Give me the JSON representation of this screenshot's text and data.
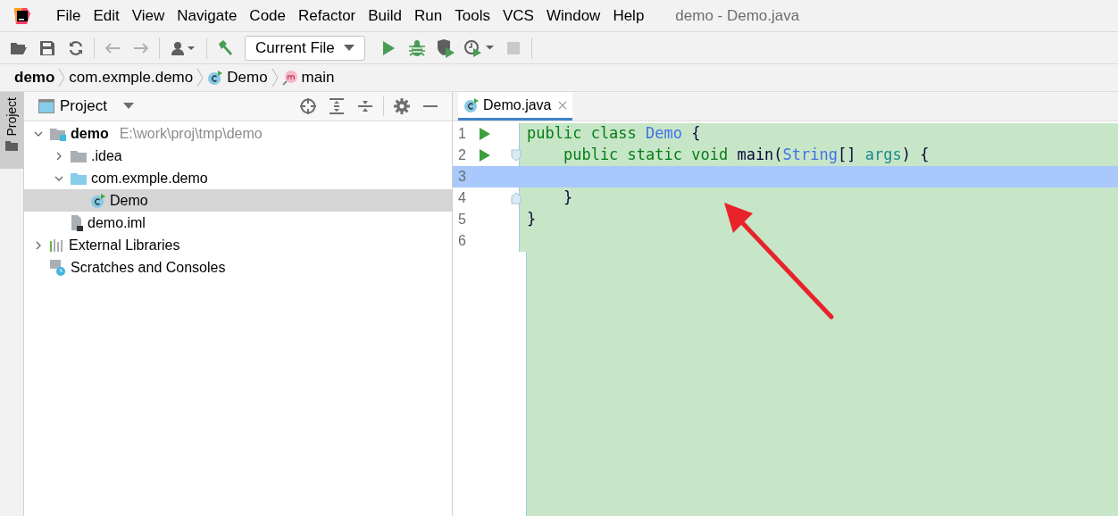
{
  "window": {
    "title": "demo - Demo.java"
  },
  "menu": [
    "File",
    "Edit",
    "View",
    "Navigate",
    "Code",
    "Refactor",
    "Build",
    "Run",
    "Tools",
    "VCS",
    "Window",
    "Help"
  ],
  "toolbar": {
    "run_config": "Current File"
  },
  "breadcrumbs": [
    {
      "label": "demo",
      "kind": "project"
    },
    {
      "label": "com.exmple.demo",
      "kind": "package"
    },
    {
      "label": "Demo",
      "kind": "class"
    },
    {
      "label": "main",
      "kind": "method"
    }
  ],
  "side_tab": {
    "label": "Project",
    "selected": true
  },
  "project_panel": {
    "title": "Project",
    "tree": [
      {
        "label": "demo",
        "hint": "E:\\work\\proj\\tmp\\demo",
        "kind": "module",
        "expanded": true,
        "selected": false,
        "children": [
          {
            "label": ".idea",
            "kind": "folder",
            "expanded": false,
            "selected": false
          },
          {
            "label": "com.exmple.demo",
            "kind": "package",
            "expanded": true,
            "selected": false,
            "children": [
              {
                "label": "Demo",
                "kind": "class",
                "selected": true
              }
            ]
          },
          {
            "label": "demo.iml",
            "kind": "file",
            "selected": false
          }
        ]
      },
      {
        "label": "External Libraries",
        "kind": "libraries",
        "expanded": false,
        "selected": false
      },
      {
        "label": "Scratches and Consoles",
        "kind": "scratches",
        "selected": false
      }
    ]
  },
  "editor": {
    "tabs": [
      {
        "label": "Demo.java",
        "selected": true
      }
    ],
    "lines": [
      {
        "number": "1",
        "run": true,
        "fold_start": false,
        "fold_end": false,
        "selected": false,
        "tokens": [
          {
            "t": "public class ",
            "kind": "keyword"
          },
          {
            "t": "Demo",
            "kind": "type"
          },
          {
            "t": " {",
            "kind": "plain"
          }
        ]
      },
      {
        "number": "2",
        "run": true,
        "fold_start": true,
        "fold_end": false,
        "selected": false,
        "tokens": [
          {
            "t": "    public static void ",
            "kind": "keyword"
          },
          {
            "t": "main",
            "kind": "plain"
          },
          {
            "t": "(",
            "kind": "plain"
          },
          {
            "t": "String",
            "kind": "type"
          },
          {
            "t": "[] ",
            "kind": "plain"
          },
          {
            "t": "args",
            "kind": "param"
          },
          {
            "t": ") {",
            "kind": "plain"
          }
        ]
      },
      {
        "number": "3",
        "run": false,
        "fold_start": false,
        "fold_end": false,
        "selected": true
      },
      {
        "number": "4",
        "run": false,
        "fold_start": false,
        "fold_end": true,
        "selected": false,
        "tokens": [
          {
            "t": "    }",
            "kind": "plain"
          }
        ]
      },
      {
        "number": "5",
        "run": false,
        "fold_start": false,
        "fold_end": false,
        "selected": false,
        "tokens": [
          {
            "t": "}",
            "kind": "plain"
          }
        ]
      },
      {
        "number": "6",
        "run": false,
        "fold_start": false,
        "fold_end": false,
        "selected": false
      }
    ]
  }
}
